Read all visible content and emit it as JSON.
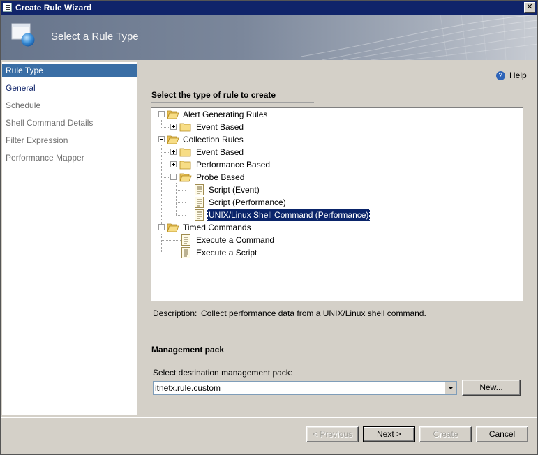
{
  "window": {
    "title": "Create Rule Wizard",
    "close_glyph": "✕"
  },
  "banner": {
    "title": "Select a Rule Type"
  },
  "nav": {
    "items": [
      {
        "label": "Rule Type",
        "state": "selected"
      },
      {
        "label": "General",
        "state": "link"
      },
      {
        "label": "Schedule",
        "state": "disabled"
      },
      {
        "label": "Shell Command Details",
        "state": "disabled"
      },
      {
        "label": "Filter Expression",
        "state": "disabled"
      },
      {
        "label": "Performance Mapper",
        "state": "disabled"
      }
    ]
  },
  "help": {
    "label": "Help",
    "icon": "?"
  },
  "rule_type": {
    "section_title": "Select the type of rule to create",
    "tree": [
      {
        "label": "Alert Generating Rules",
        "level": 0,
        "icon": "folder-open-icon",
        "expander": "minus"
      },
      {
        "label": "Event Based",
        "level": 1,
        "icon": "folder-icon",
        "expander": "plus"
      },
      {
        "label": "Collection Rules",
        "level": 0,
        "icon": "folder-open-icon",
        "expander": "minus"
      },
      {
        "label": "Event Based",
        "level": 1,
        "icon": "folder-icon",
        "expander": "plus"
      },
      {
        "label": "Performance Based",
        "level": 1,
        "icon": "folder-icon",
        "expander": "plus"
      },
      {
        "label": "Probe Based",
        "level": 1,
        "icon": "folder-open-icon",
        "expander": "minus"
      },
      {
        "label": "Script (Event)",
        "level": 2,
        "icon": "script-icon"
      },
      {
        "label": "Script (Performance)",
        "level": 2,
        "icon": "script-icon"
      },
      {
        "label": "UNIX/Linux Shell Command (Performance)",
        "level": 2,
        "icon": "script-icon",
        "selected": true
      },
      {
        "label": "Timed Commands",
        "level": 0,
        "icon": "folder-open-icon",
        "expander": "minus"
      },
      {
        "label": "Execute a Command",
        "level": 1,
        "icon": "script-icon"
      },
      {
        "label": "Execute a Script",
        "level": 1,
        "icon": "script-icon"
      }
    ],
    "description_label": "Description:",
    "description_text": "Collect performance data from a UNIX/Linux shell command."
  },
  "management_pack": {
    "section_title": "Management pack",
    "field_label": "Select destination management pack:",
    "selected_value": "itnetx.rule.custom",
    "new_button": "New..."
  },
  "footer": {
    "previous": "< Previous",
    "next": "Next >",
    "create": "Create",
    "cancel": "Cancel"
  },
  "colors": {
    "titlebar": "#10246a",
    "selection": "#0a246a",
    "nav_selected": "#3a6ea5"
  }
}
